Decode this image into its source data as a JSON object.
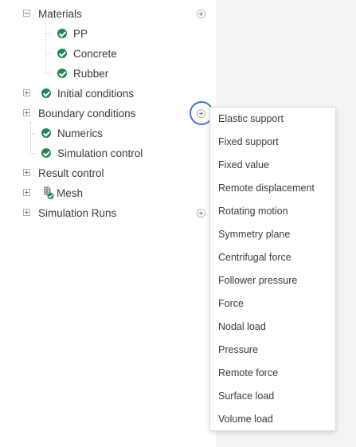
{
  "tree": {
    "materials": {
      "label": "Materials",
      "children": [
        "PP",
        "Concrete",
        "Rubber"
      ]
    },
    "initial_conditions": "Initial conditions",
    "boundary_conditions": "Boundary conditions",
    "numerics": "Numerics",
    "simulation_control": "Simulation control",
    "result_control": "Result control",
    "mesh": "Mesh",
    "simulation_runs": "Simulation Runs"
  },
  "context_menu": {
    "items": [
      "Elastic support",
      "Fixed support",
      "Fixed value",
      "Remote displacement",
      "Rotating motion",
      "Symmetry plane",
      "Centrifugal force",
      "Follower pressure",
      "Force",
      "Nodal load",
      "Pressure",
      "Remote force",
      "Surface load",
      "Volume load"
    ]
  },
  "icons": {
    "status": "check-circle-icon",
    "expand": "plus-square-icon",
    "collapse": "minus-square-icon",
    "add": "plus-circle-icon",
    "mesh": "mesh-icon"
  },
  "colors": {
    "check_green": "#1d8a52",
    "focus_ring": "#3b74e0"
  }
}
